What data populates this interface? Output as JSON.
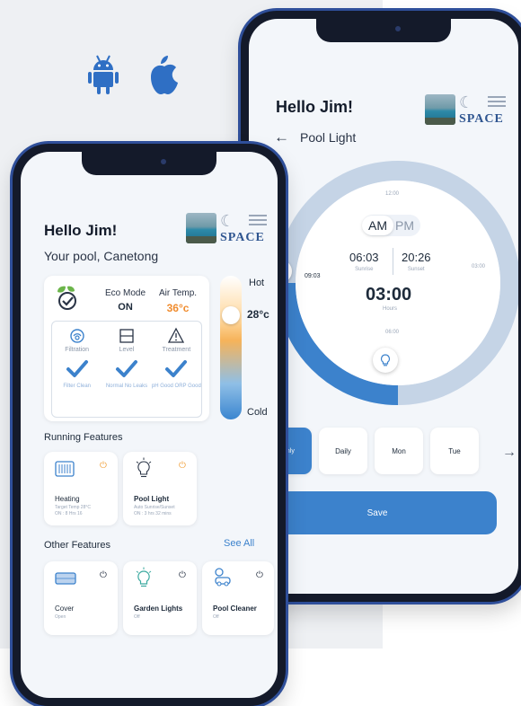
{
  "colors": {
    "accent": "#3c82cc",
    "warm": "#f08c2e",
    "ring": "#c5d4e6"
  },
  "platforms": [
    {
      "icon": "android-icon"
    },
    {
      "icon": "apple-icon"
    }
  ],
  "back_screen": {
    "greeting": "Hello Jim!",
    "back_label": "Pool Light",
    "brand": "SPACE",
    "dial": {
      "ticks": {
        "top": "12:00",
        "right": "03:00",
        "bottom": "06:00"
      },
      "am": "AM",
      "pm": "PM",
      "sunrise_time": "06:03",
      "sunrise_label": "Sunrise",
      "sunset_time": "20:26",
      "sunset_label": "Sunset",
      "start_time": "09:03",
      "duration": "03:00",
      "duration_unit": "Hours"
    },
    "repeat_label": "peat",
    "chips": [
      "Weekend Only",
      "Daily",
      "Mon",
      "Tue"
    ],
    "save_label": "Save"
  },
  "front_screen": {
    "greeting": "Hello Jim!",
    "pool": "Your pool, Canetong",
    "brand": "SPACE",
    "eco_label": "Eco Mode",
    "eco_value": "ON",
    "air_label": "Air Temp.",
    "air_value": "36°c",
    "status": [
      {
        "name": "Filtration",
        "state": "Filter Clean"
      },
      {
        "name": "Level",
        "state": "Normal No Leaks"
      },
      {
        "name": "Treatment",
        "state": "pH Good ORP Good"
      }
    ],
    "slider": {
      "hot": "Hot",
      "temp": "28°c",
      "cold": "Cold",
      "level": 0.78
    },
    "running_title": "Running Features",
    "running": [
      {
        "title": "Heating",
        "sub1": "Target Temp 28°C",
        "sub2": "ON : 8 Hrs 16",
        "icon": "heater-icon"
      },
      {
        "title": "Pool Light",
        "sub1": "Auto Sunrise/Sunset",
        "sub2": "ON : 3 hrs 32 mins",
        "icon": "bulb-icon"
      }
    ],
    "other_title": "Other Features",
    "see_all": "See All",
    "other": [
      {
        "title": "Cover",
        "sub": "Open",
        "icon": "cover-icon"
      },
      {
        "title": "Garden Lights",
        "sub": "Off",
        "icon": "garden-light-icon"
      },
      {
        "title": "Pool Cleaner",
        "sub": "Off",
        "icon": "pool-cleaner-icon"
      }
    ]
  }
}
